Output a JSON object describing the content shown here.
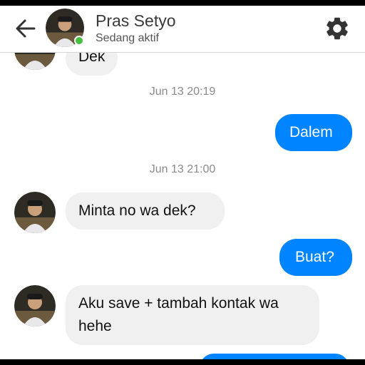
{
  "header": {
    "back_icon": "arrow-left-icon",
    "name": "Pras Setyo",
    "status": "Sedang aktif",
    "settings_icon": "gear-icon",
    "online_color": "#44c041"
  },
  "messages": [
    {
      "type": "in",
      "text": "Dek"
    },
    {
      "type": "timestamp",
      "text": "Jun 13 20:19"
    },
    {
      "type": "out",
      "text": "Dalem"
    },
    {
      "type": "timestamp",
      "text": "Jun 13 21:00"
    },
    {
      "type": "in",
      "text": "Minta no wa dek?"
    },
    {
      "type": "out",
      "text": "Buat?"
    },
    {
      "type": "in",
      "text": "Aku save + tambah kontak wa hehe"
    }
  ],
  "colors": {
    "outgoing_bubble": "#0084ff",
    "incoming_bubble": "#f0f0f0",
    "timestamp_text": "#8a8a8a"
  }
}
